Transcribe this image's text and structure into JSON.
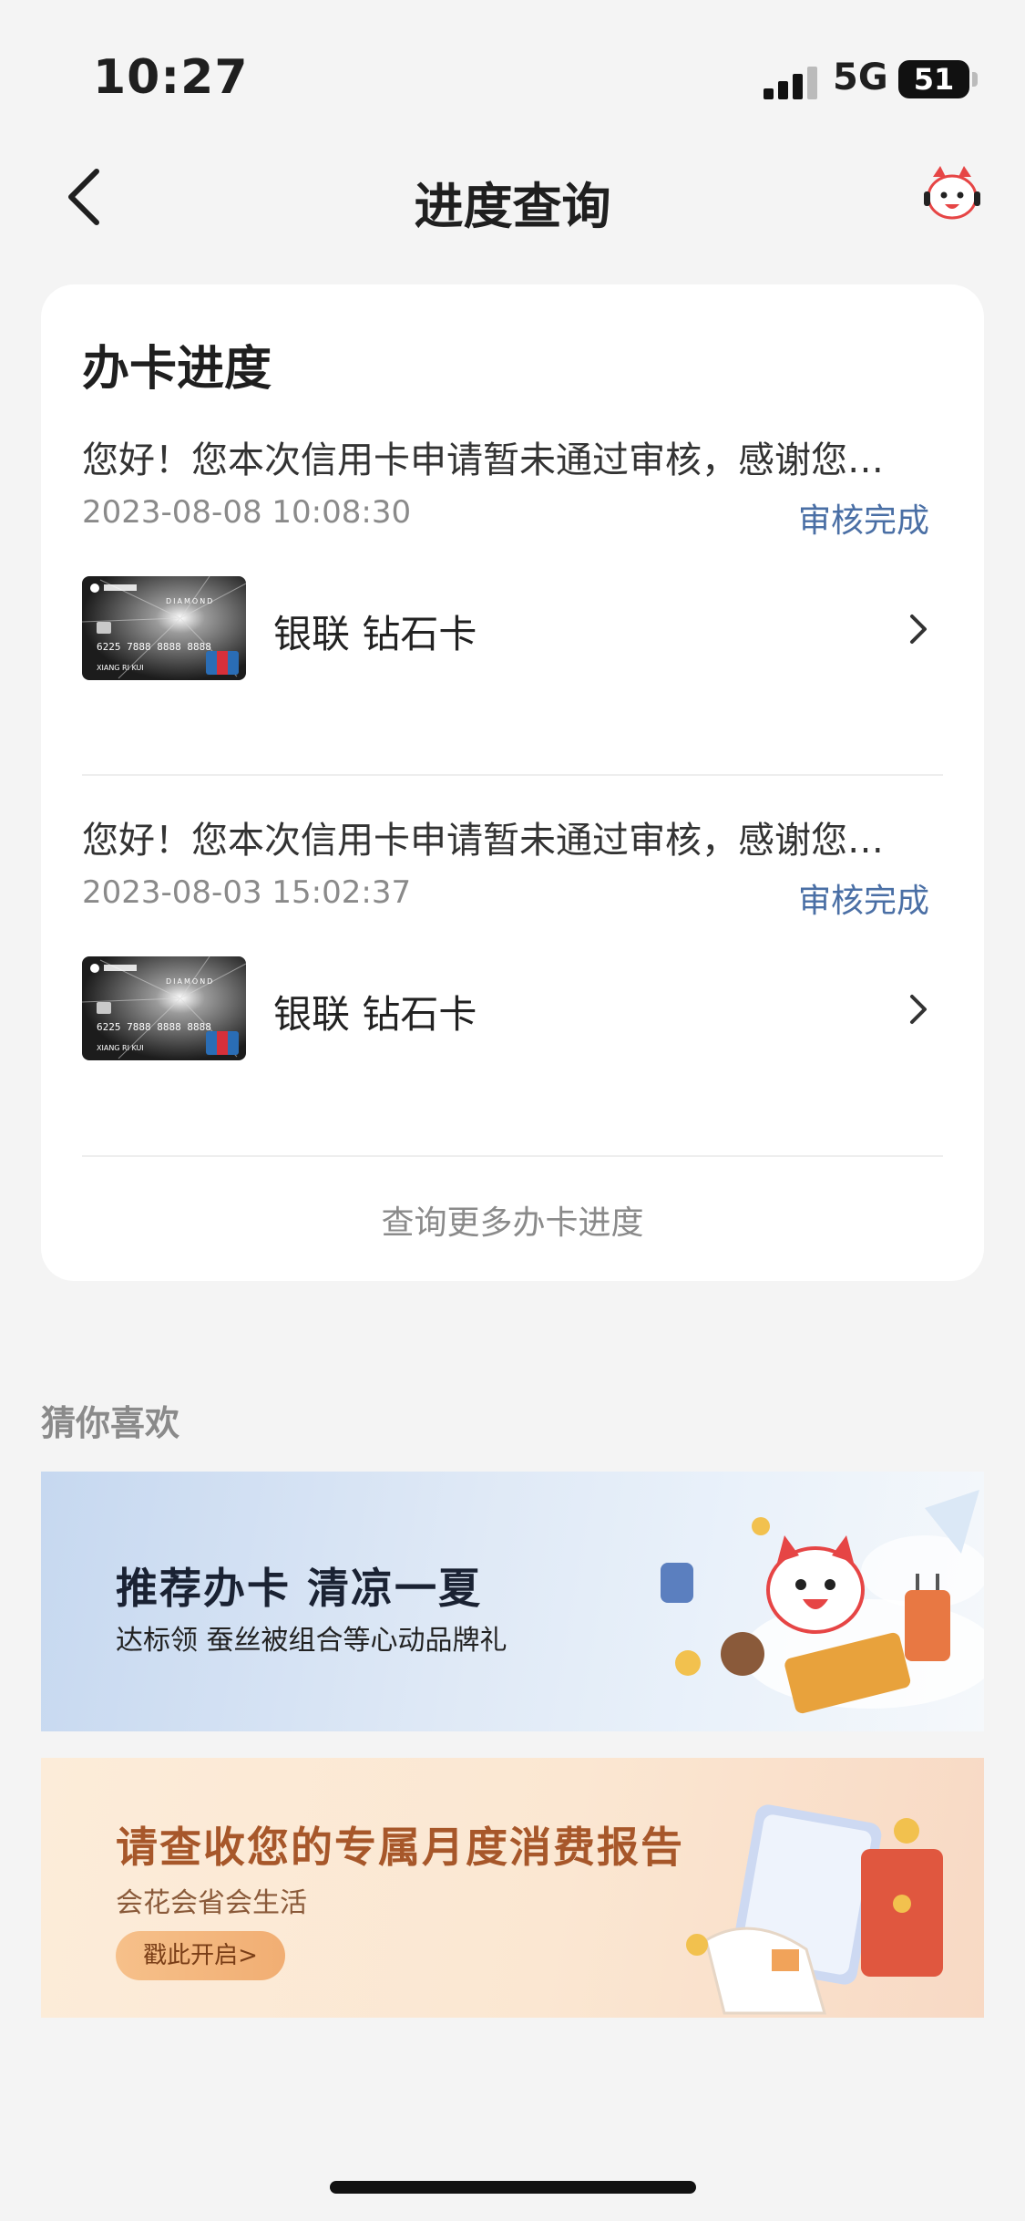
{
  "status_bar": {
    "time": "10:27",
    "network": "5G",
    "battery": "51"
  },
  "nav": {
    "title": "进度查询"
  },
  "progress_card": {
    "title": "办卡进度",
    "records": [
      {
        "message": "您好！您本次信用卡申请暂未通过审核，感谢您…",
        "date": "2023-08-08 10:08:30",
        "status": "审核完成",
        "card_name": "银联 钻石卡",
        "card_number": "6225 7888 8888 8888",
        "card_holder": "XIANG RI KUI",
        "card_brand": "DIAMOND"
      },
      {
        "message": "您好！您本次信用卡申请暂未通过审核，感谢您…",
        "date": "2023-08-03 15:02:37",
        "status": "审核完成",
        "card_name": "银联 钻石卡",
        "card_number": "6225 7888 8888 8888",
        "card_holder": "XIANG RI KUI",
        "card_brand": "DIAMOND"
      }
    ],
    "more_link": "查询更多办卡进度"
  },
  "recommend": {
    "title": "猜你喜欢",
    "banners": [
      {
        "headline": "推荐办卡 清凉一夏",
        "subtitle": "达标领 蚕丝被组合等心动品牌礼"
      },
      {
        "headline": "请查收您的专属月度消费报告",
        "subtitle": "会花会省会生活",
        "button": "戳此开启>"
      }
    ]
  },
  "colors": {
    "accent_blue": "#4a6fa5",
    "banner_orange": "#a7572a"
  }
}
